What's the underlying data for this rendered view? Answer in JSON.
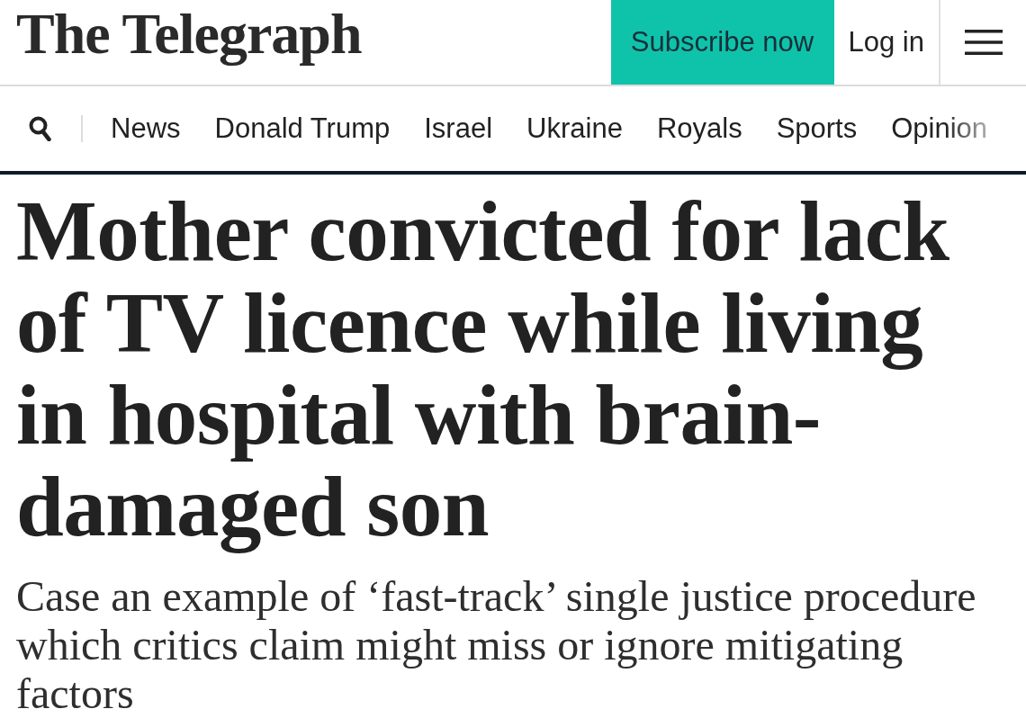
{
  "header": {
    "logo": "The Telegraph",
    "subscribe_button": "Subscribe now",
    "login_link": "Log in"
  },
  "nav": {
    "items": [
      "News",
      "Donald Trump",
      "Israel",
      "Ukraine",
      "Royals",
      "Sports",
      "Opinion"
    ]
  },
  "article": {
    "headline": "Mother convicted for lack of TV licence while living in hospital with brain-damaged son",
    "standfirst": "Case an example of ‘fast-track’ single justice procedure which critics claim might miss or ignore mitigating factors"
  }
}
